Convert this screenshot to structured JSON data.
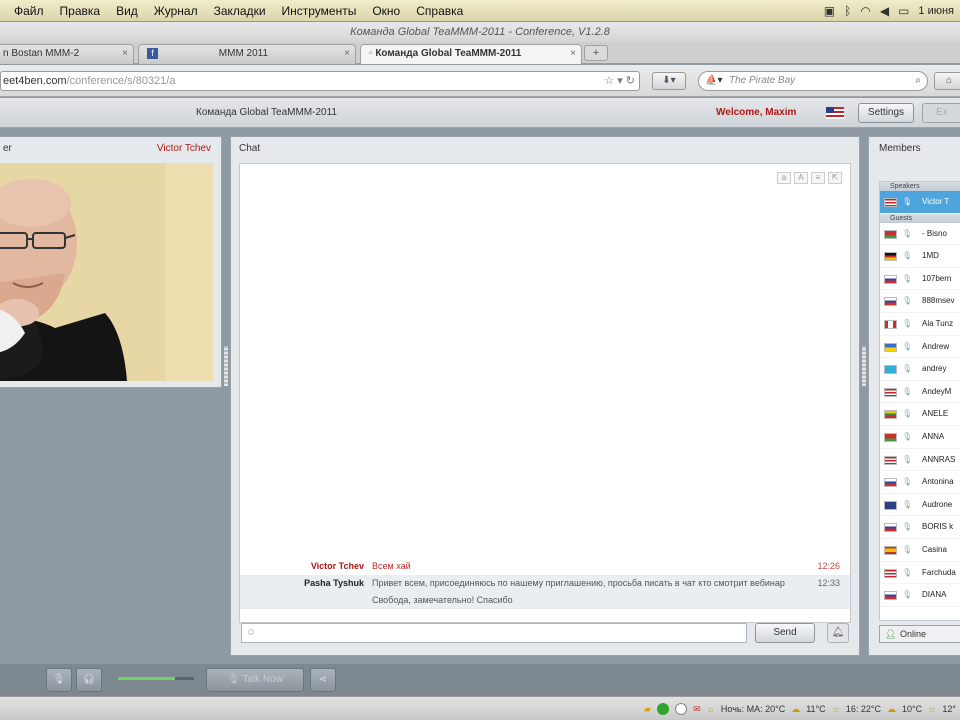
{
  "menubar": {
    "items": [
      "Файл",
      "Правка",
      "Вид",
      "Журнал",
      "Закладки",
      "Инструменты",
      "Окно",
      "Справка"
    ],
    "date": "1 июня"
  },
  "browser": {
    "window_title": "Команда Global TeaMMM-2011 - Conference, V1.2.8",
    "tabs": [
      {
        "label": "n Bostan MMM-2"
      },
      {
        "label": "MMM 2011"
      },
      {
        "label": "Команда Global TeaMMM-2011"
      }
    ],
    "new_tab": "+",
    "url_main": "eet4ben.com",
    "url_rest": "/conference/s/80321/a",
    "search_engine": "",
    "search_placeholder": "The Pirate Bay"
  },
  "app": {
    "title": "Команда Global TeaMMM-2011",
    "welcome": "Welcome, Maxim",
    "settings_label": "Settings",
    "exit_label": "Ex"
  },
  "speaker": {
    "panel_label": "er",
    "name": "Victor Tchev"
  },
  "chat": {
    "title": "Chat",
    "messages": [
      {
        "from": "Victor Tchev",
        "text": "Всем хай",
        "time": "12:26",
        "color": "#b01818"
      },
      {
        "from": "Pasha Tyshuk",
        "text": "Привет всем, присоединяюсь по нашему приглашению, просьба писать в чат кто смотрит вебинар",
        "time": "12:33",
        "color": "#222222"
      },
      {
        "from": "",
        "text": "Свобода, замечательно!  Спасибо",
        "time": "",
        "color": "#222222"
      }
    ],
    "send_label": "Send"
  },
  "members": {
    "title": "Members",
    "speakers_group": "Speakers",
    "guests_group": "Guests",
    "speaker_rows": [
      {
        "name": "Victor T",
        "flag": "us"
      }
    ],
    "rows": [
      {
        "name": "- Bisno",
        "flag": "by"
      },
      {
        "name": "1MD",
        "flag": "de"
      },
      {
        "name": "107bern",
        "flag": "ru"
      },
      {
        "name": "888msev",
        "flag": "ru"
      },
      {
        "name": "Ala Tunz",
        "flag": "ca"
      },
      {
        "name": "Andrew",
        "flag": "ua"
      },
      {
        "name": "andrey",
        "flag": "kz"
      },
      {
        "name": "AndeyM",
        "flag": "us"
      },
      {
        "name": "ANELE",
        "flag": "lt"
      },
      {
        "name": "ANNA",
        "flag": "by"
      },
      {
        "name": "ANNRAS",
        "flag": "us"
      },
      {
        "name": "Antonina",
        "flag": "ru"
      },
      {
        "name": "Audrone",
        "flag": "gb"
      },
      {
        "name": "BORIS k",
        "flag": "ru"
      },
      {
        "name": "Casina",
        "flag": "es"
      },
      {
        "name": "Farchuda",
        "flag": "us"
      },
      {
        "name": "DIANA",
        "flag": "ru"
      }
    ],
    "online_label": "Online"
  },
  "toolbar": {
    "talk_label": "Talk Now",
    "volume": 0.75
  },
  "status": {
    "weather_city": "Ночь: МА: 20°С",
    "t1": "11°С",
    "t2": "16: 22°С",
    "t3": "10°С",
    "t4": "12°"
  }
}
